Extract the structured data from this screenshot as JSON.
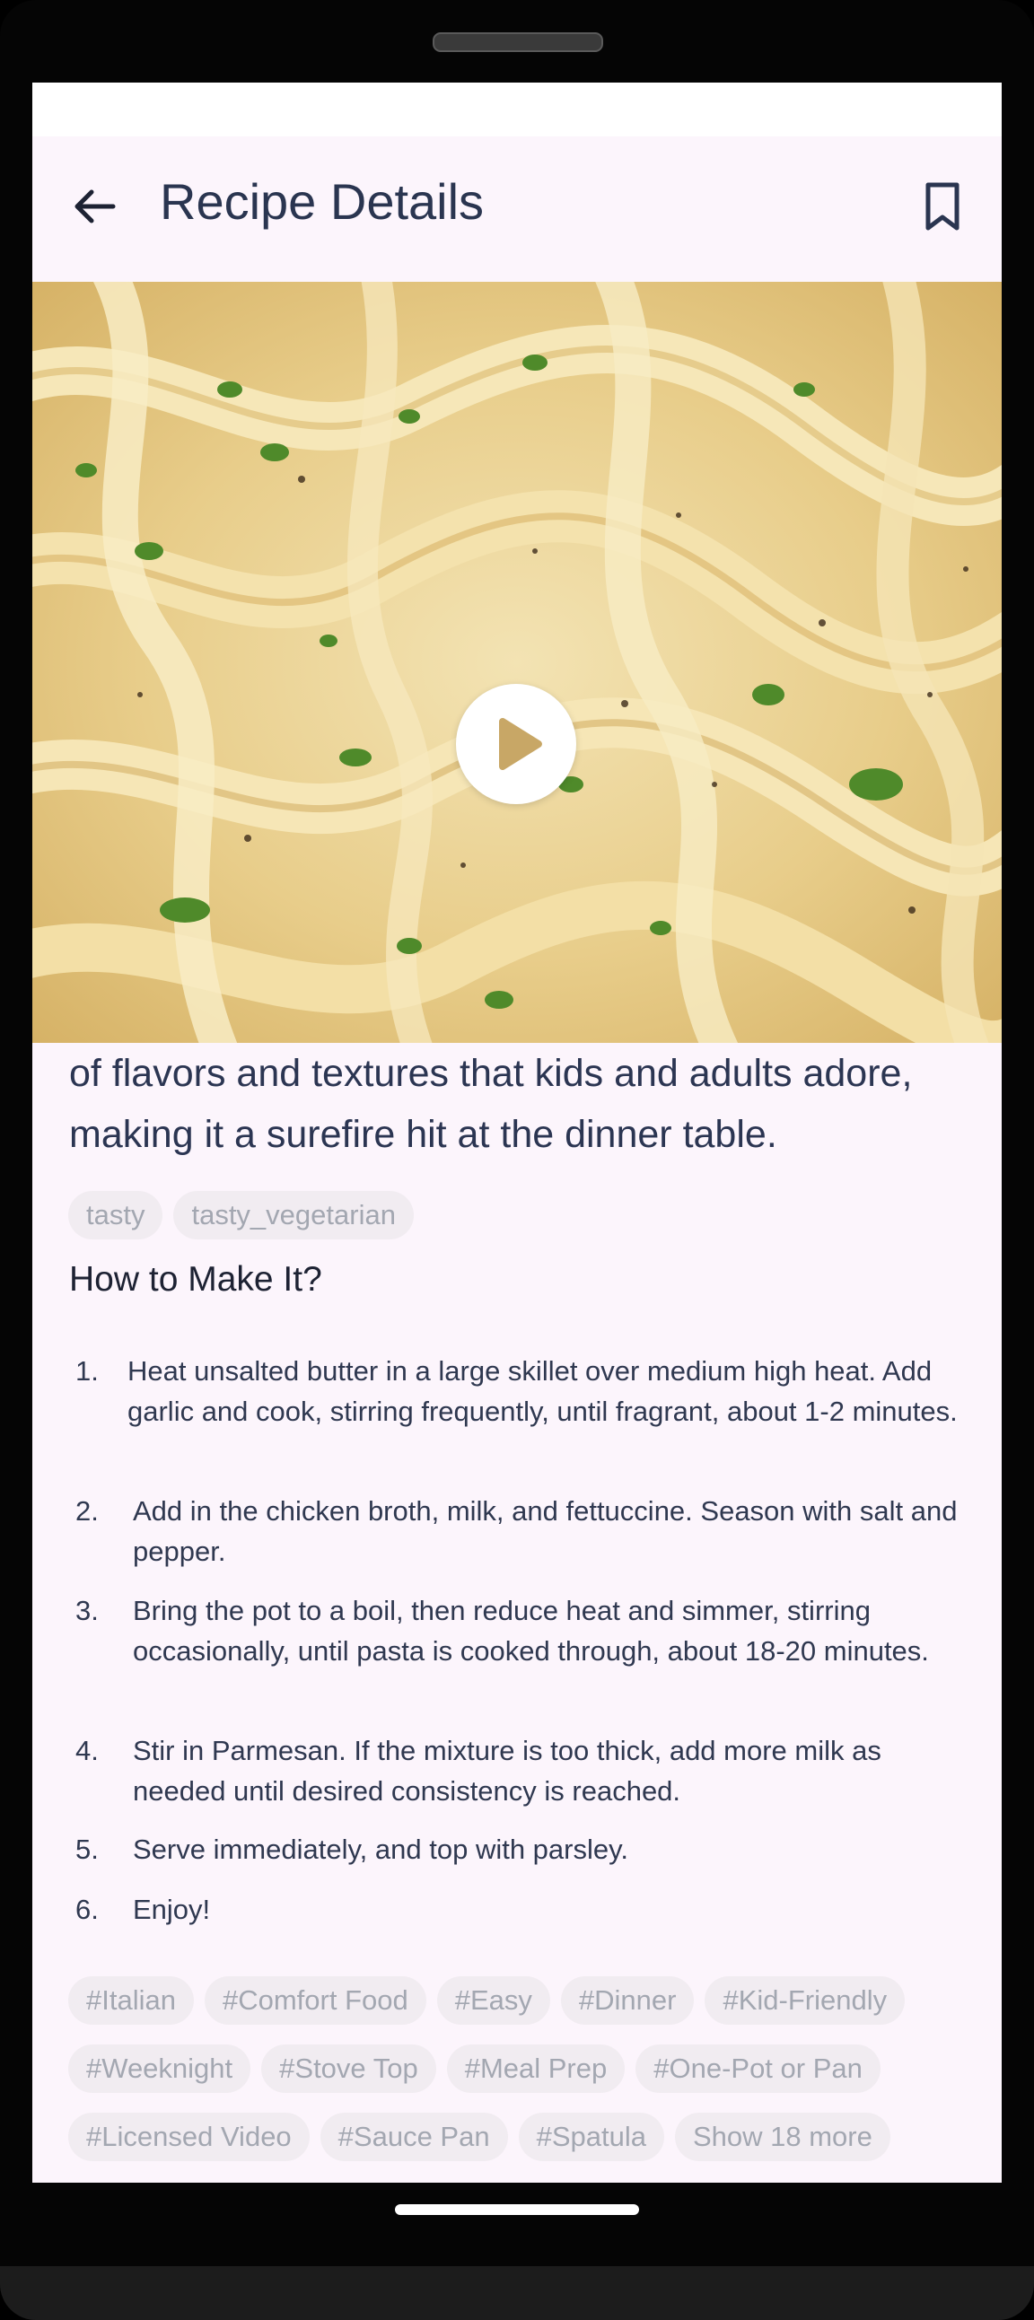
{
  "app": {
    "title": "Recipe Details"
  },
  "description_text": "of flavors and textures that kids and adults adore, making it a surefire hit at the dinner table.",
  "tags": [
    "tasty",
    "tasty_vegetarian"
  ],
  "instructions_heading": "How to Make It?",
  "steps": [
    {
      "num": "1.",
      "text": "Heat unsalted butter in a large skillet over medium high heat. Add garlic and cook, stirring frequently, until fragrant, about 1-2 minutes."
    },
    {
      "num": "2.",
      "text": "Add in the chicken broth, milk, and fettuccine. Season with salt and pepper."
    },
    {
      "num": "3.",
      "text": "Bring the pot to a boil, then reduce heat and simmer, stirring occasionally, until pasta is cooked through, about 18-20 minutes."
    },
    {
      "num": "4.",
      "text": "Stir in Parmesan. If the mixture is too thick, add more milk as needed until desired consistency is reached."
    },
    {
      "num": "5.",
      "text": "Serve immediately, and top with parsley."
    },
    {
      "num": "6.",
      "text": "Enjoy!"
    }
  ],
  "hashtags": {
    "row1": [
      "#Italian",
      "#Comfort Food",
      "#Easy",
      "#Dinner",
      "#Kid-Friendly"
    ],
    "row2": [
      "#Weeknight",
      "#Stove Top",
      "#Meal Prep",
      "#One-Pot or Pan"
    ],
    "row3": [
      "#Licensed Video",
      "#Sauce Pan",
      "#Spatula"
    ]
  },
  "show_more_label": "Show 18 more",
  "icons": {
    "back": "arrow-back-icon",
    "bookmark": "bookmark-icon",
    "play": "play-icon"
  },
  "colors": {
    "background": "#fcf5fc",
    "title": "#2a3550",
    "chip_bg": "#f1ecf1",
    "chip_text": "#a3a7b1",
    "play_triangle": "#c8a766"
  }
}
